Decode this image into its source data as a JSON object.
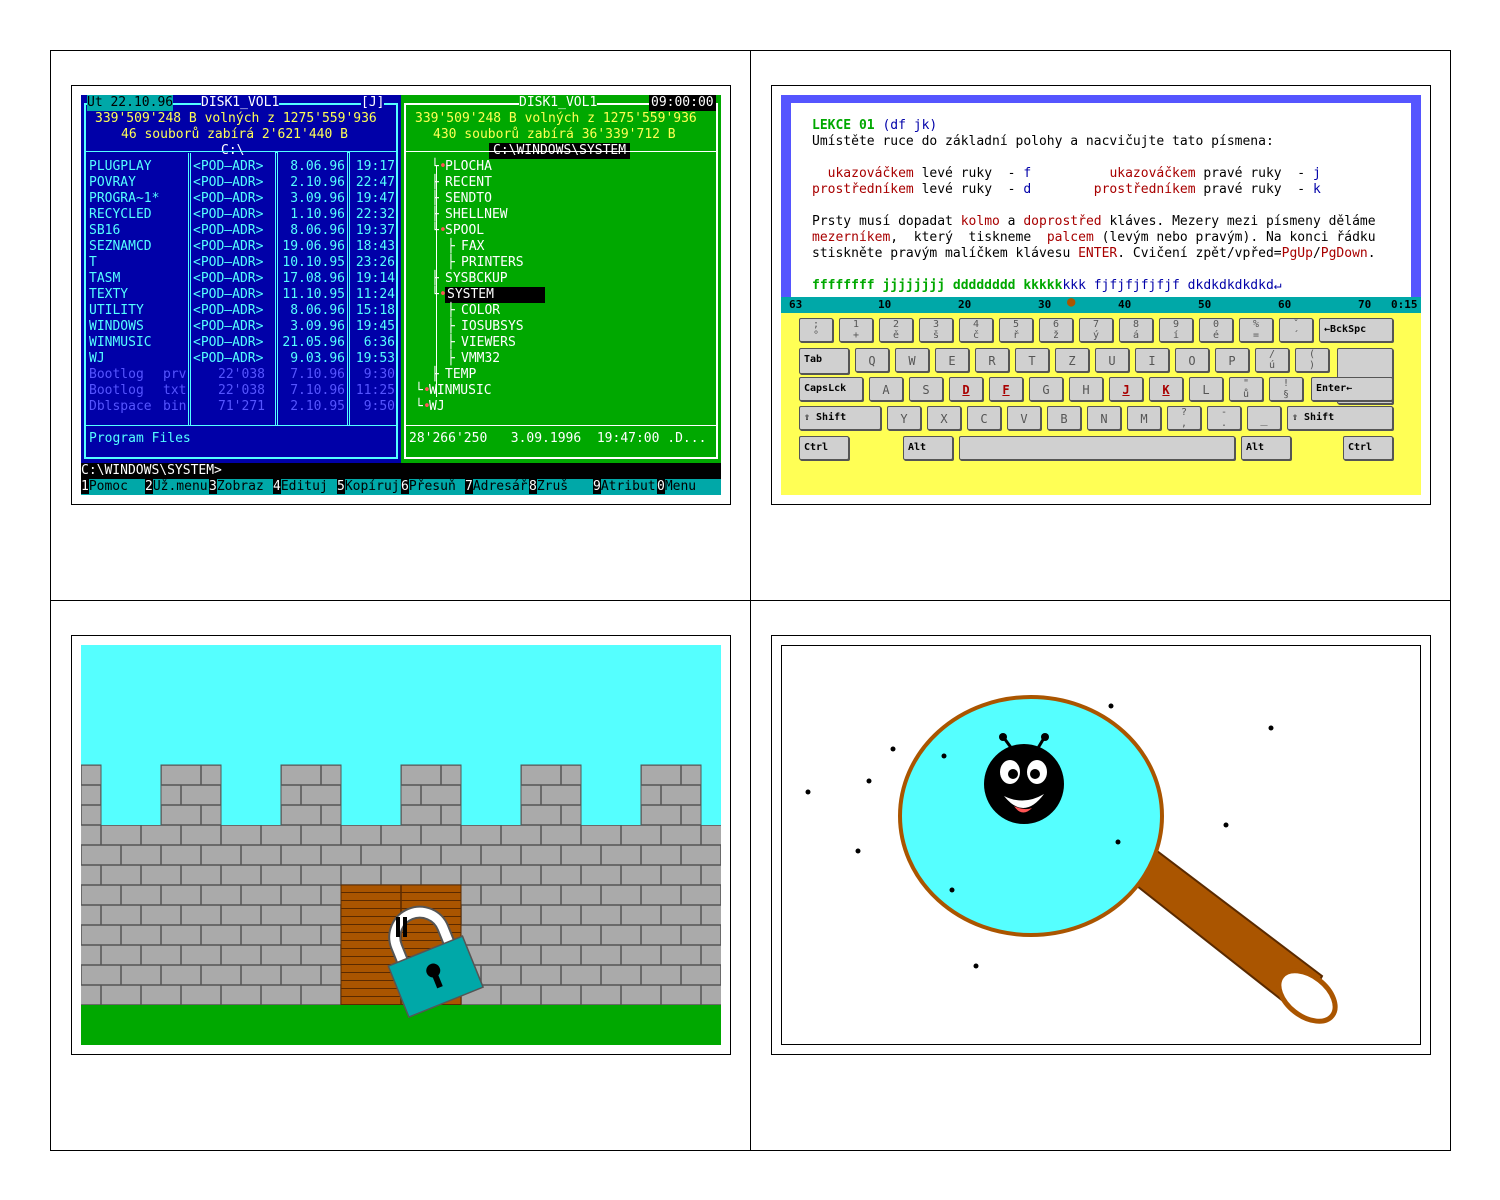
{
  "norton": {
    "left": {
      "date": "Út 22.10.96",
      "volume": "DISK1_VOL1",
      "tag": "[J]",
      "free_line": "339'509'248 B volných z 1275'559'936",
      "files_line": "46 souborů zabírá 2'621'440 B",
      "path": "C:\\",
      "entries": [
        {
          "name": "PLUGPLAY",
          "ext": "",
          "size": "<POD—ADR>",
          "date": "8.06.96",
          "time": "19:17"
        },
        {
          "name": "POVRAY",
          "ext": "",
          "size": "<POD—ADR>",
          "date": "2.10.96",
          "time": "22:47"
        },
        {
          "name": "PROGRA~1*",
          "ext": "",
          "size": "<POD—ADR>",
          "date": "3.09.96",
          "time": "19:47"
        },
        {
          "name": "RECYCLED",
          "ext": "",
          "size": "<POD—ADR>",
          "date": "1.10.96",
          "time": "22:32"
        },
        {
          "name": "SB16",
          "ext": "",
          "size": "<POD—ADR>",
          "date": "8.06.96",
          "time": "19:37"
        },
        {
          "name": "SEZNAMCD",
          "ext": "",
          "size": "<POD—ADR>",
          "date": "19.06.96",
          "time": "18:43"
        },
        {
          "name": "T",
          "ext": "",
          "size": "<POD—ADR>",
          "date": "10.10.95",
          "time": "23:26"
        },
        {
          "name": "TASM",
          "ext": "",
          "size": "<POD—ADR>",
          "date": "17.08.96",
          "time": "19:14"
        },
        {
          "name": "TEXTY",
          "ext": "",
          "size": "<POD—ADR>",
          "date": "11.10.95",
          "time": "11:24"
        },
        {
          "name": "UTILITY",
          "ext": "",
          "size": "<POD—ADR>",
          "date": "8.06.96",
          "time": "15:18"
        },
        {
          "name": "WINDOWS",
          "ext": "",
          "size": "<POD—ADR>",
          "date": "3.09.96",
          "time": "19:45"
        },
        {
          "name": "WINMUSIC",
          "ext": "",
          "size": "<POD—ADR>",
          "date": "21.05.96",
          "time": "6:36"
        },
        {
          "name": "WJ",
          "ext": "",
          "size": "<POD—ADR>",
          "date": "9.03.96",
          "time": "19:53"
        },
        {
          "name": "Bootlog",
          "ext": "prv",
          "size": "22'038",
          "date": "7.10.96",
          "time": "9:30"
        },
        {
          "name": "Bootlog",
          "ext": "txt",
          "size": "22'038",
          "date": "7.10.96",
          "time": "11:25"
        },
        {
          "name": "Dblspace",
          "ext": "bin",
          "size": "71'271",
          "date": "2.10.95",
          "time": "9:50"
        }
      ],
      "status": "Program Files"
    },
    "right": {
      "volume": "DISK1_VOL1",
      "clock": "09:00:00",
      "free_line": "339'509'248 B volných z 1275'559'936",
      "files_line": "430 souborů zabírá 36'339'712 B",
      "path": "C:\\WINDOWS\\SYSTEM",
      "tree": [
        "PLOCHA",
        "RECENT",
        "SENDTO",
        "SHELLNEW",
        "SPOOL",
        "FAX",
        "PRINTERS",
        "SYSBCKUP",
        "SYSTEM",
        "COLOR",
        "IOSUBSYS",
        "VIEWERS",
        "VMM32",
        "TEMP",
        "WINMUSIC",
        "WJ"
      ],
      "status": "28'266'250   3.09.1996  19:47:00 .D..."
    },
    "prompt": "C:\\WINDOWS\\SYSTEM>",
    "fkeys": [
      {
        "n": "1",
        "l": "Pomoc"
      },
      {
        "n": "2",
        "l": "Už.menu"
      },
      {
        "n": "3",
        "l": "Zobraz"
      },
      {
        "n": "4",
        "l": "Edituj"
      },
      {
        "n": "5",
        "l": "Kopíruj"
      },
      {
        "n": "6",
        "l": "Přesuň"
      },
      {
        "n": "7",
        "l": "Adresář"
      },
      {
        "n": "8",
        "l": "Zruš"
      },
      {
        "n": "9",
        "l": "Atribut"
      },
      {
        "n": "0",
        "l": "Menu"
      }
    ]
  },
  "typing": {
    "lesson": "LEKCE 01",
    "lesson_keys": "(df jk)",
    "intro": "Umístěte ruce do základní polohy a nacvičujte tato písmena:",
    "l1_a": "ukazováčkem",
    "l1_b": " levé ruky  - ",
    "l1_c": "f",
    "l1_d": "ukazováčkem",
    "l1_e": " pravé ruky  - ",
    "l1_f": "j",
    "l2_a": "prostředníkem",
    "l2_b": " levé ruky  - ",
    "l2_c": "d",
    "l2_d": "prostředníkem",
    "l2_e": " pravé ruky  - ",
    "l2_f": "k",
    "p1_a": "Prsty musí dopadat ",
    "p1_b": "kolmo",
    "p1_c": " a ",
    "p1_d": "doprostřed",
    "p1_e": " kláves. Mezery mezi písmeny děláme",
    "p2_a": "mezerníkem",
    "p2_b": ",  který  tiskneme  ",
    "p2_c": "palcem",
    "p2_d": " (levým nebo pravým). Na konci řádku",
    "p3_a": "stiskněte pravým malíčkem klávesu ",
    "p3_b": "ENTER",
    "p3_c": ". Cvičení zpět/vpřed=",
    "p3_d": "PgUp",
    "p3_e": "/",
    "p3_f": "PgDown",
    "p3_g": ".",
    "drill_typed": "ffffffff jjjjjjjj dddddddd kkkkk",
    "drill_rest": "kkk fjfjfjfjfjf dkdkdkdkdkd↵",
    "ruler": {
      "start": "63",
      "m10": "10",
      "m20": "20",
      "m30": "30",
      "m40": "40",
      "m50": "50",
      "m60": "60",
      "m70": "70",
      "time": "0:15"
    },
    "keys": {
      "row1": [
        ";",
        "1",
        "2",
        "3",
        "4",
        "5",
        "6",
        "7",
        "8",
        "9",
        "0",
        "%",
        "ˇ"
      ],
      "row1b": [
        "°",
        "+",
        "ě",
        "š",
        "č",
        "ř",
        "ž",
        "ý",
        "á",
        "í",
        "é",
        "=",
        "´"
      ],
      "backspace": "←BckSpc",
      "tab": "Tab",
      "row2": [
        "Q",
        "W",
        "E",
        "R",
        "T",
        "Z",
        "U",
        "I",
        "O",
        "P",
        "/",
        "("
      ],
      "row2b": [
        "",
        "",
        "",
        "",
        "",
        "",
        "",
        "",
        "",
        "",
        "ú",
        ")"
      ],
      "caps": "CapsLck",
      "row3": [
        "A",
        "S",
        "D",
        "F",
        "G",
        "H",
        "J",
        "K",
        "L",
        "\"",
        "!"
      ],
      "row3b": [
        "",
        "",
        "",
        "",
        "",
        "",
        "",
        "",
        "",
        "ů",
        "§"
      ],
      "enter": "Enter←",
      "shift": "⇧ Shift",
      "row4": [
        "Y",
        "X",
        "C",
        "V",
        "B",
        "N",
        "M",
        "?",
        "-",
        "_"
      ],
      "row4b": [
        "",
        "",
        "",
        "",
        "",
        "",
        "",
        ",",
        ".",
        ""
      ],
      "ctrl": "Ctrl",
      "alt": "Alt"
    },
    "highlight_keys": [
      "D",
      "F",
      "J",
      "K"
    ]
  }
}
